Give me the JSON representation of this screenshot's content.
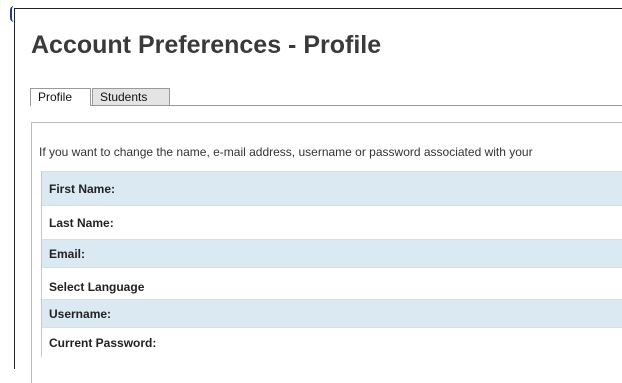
{
  "page": {
    "title": "Account Preferences - Profile"
  },
  "tabs": [
    {
      "label": "Profile",
      "active": true
    },
    {
      "label": "Students",
      "active": false
    }
  ],
  "panel": {
    "intro_text": "If you want to change the name, e-mail address, username or password associated with your",
    "fields": [
      {
        "label": "First Name:"
      },
      {
        "label": "Last Name:"
      },
      {
        "label": "Email:"
      },
      {
        "label": "Select Language"
      },
      {
        "label": "Username:"
      },
      {
        "label": "Current Password:"
      }
    ]
  },
  "colors": {
    "row_shaded": "#dbe9f2",
    "title_text": "#3a3a3a",
    "corner_accent": "#1a3d8f"
  }
}
